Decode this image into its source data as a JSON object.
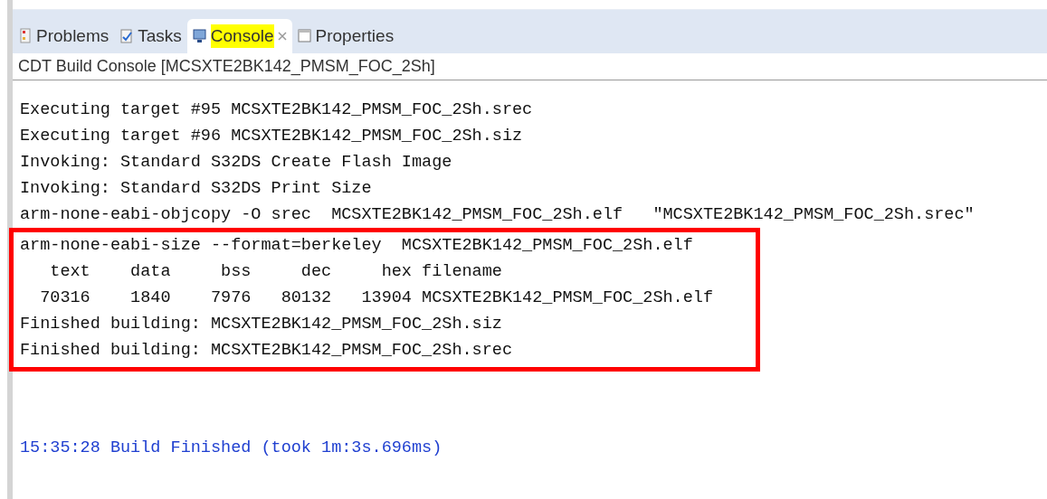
{
  "tabs": [
    {
      "label": "Problems",
      "kind": "problems",
      "selected": false
    },
    {
      "label": "Tasks",
      "kind": "tasks",
      "selected": false
    },
    {
      "label": "Console",
      "kind": "console",
      "selected": true,
      "closable": true
    },
    {
      "label": "Properties",
      "kind": "properties",
      "selected": false
    }
  ],
  "console": {
    "title": "CDT Build Console [MCSXTE2BK142_PMSM_FOC_2Sh]",
    "blocks": [
      {
        "kind": "plain",
        "lines": [
          "Executing target #95 MCSXTE2BK142_PMSM_FOC_2Sh.srec",
          "Executing target #96 MCSXTE2BK142_PMSM_FOC_2Sh.siz",
          "Invoking: Standard S32DS Create Flash Image",
          "Invoking: Standard S32DS Print Size",
          "arm-none-eabi-objcopy -O srec  MCSXTE2BK142_PMSM_FOC_2Sh.elf   \"MCSXTE2BK142_PMSM_FOC_2Sh.srec\""
        ]
      },
      {
        "kind": "boxed",
        "lines": [
          "arm-none-eabi-size --format=berkeley  MCSXTE2BK142_PMSM_FOC_2Sh.elf",
          "   text    data     bss     dec     hex filename",
          "  70316    1840    7976   80132   13904 MCSXTE2BK142_PMSM_FOC_2Sh.elf",
          "Finished building: MCSXTE2BK142_PMSM_FOC_2Sh.siz",
          "Finished building: MCSXTE2BK142_PMSM_FOC_2Sh.srec"
        ]
      },
      {
        "kind": "status",
        "lines": [
          "15:35:28 Build Finished (took 1m:3s.696ms)"
        ]
      }
    ]
  }
}
